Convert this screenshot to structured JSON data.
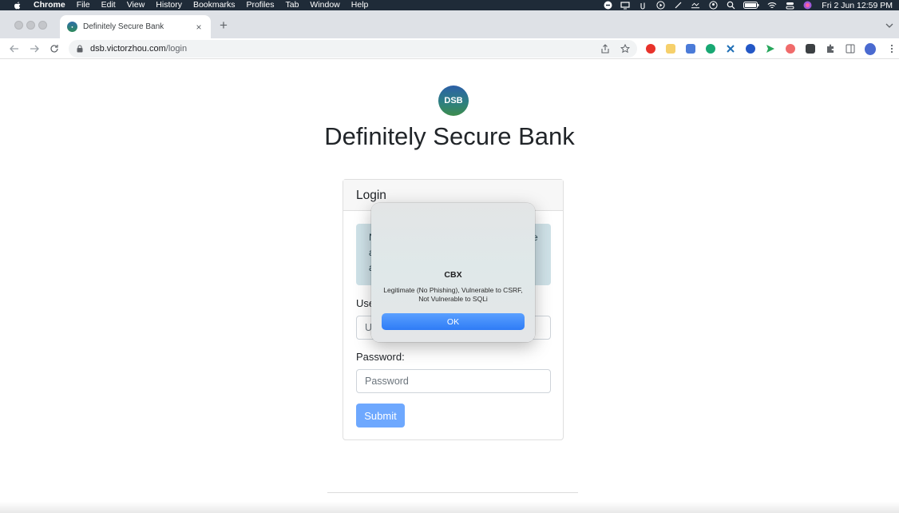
{
  "menubar": {
    "app_name": "Chrome",
    "items": [
      "File",
      "Edit",
      "View",
      "History",
      "Bookmarks",
      "Profiles",
      "Tab",
      "Window",
      "Help"
    ],
    "clock": "Fri 2 Jun  12:59 PM"
  },
  "browser": {
    "tab_title": "Definitely Secure Bank",
    "url_host": "dsb.victorzhou.com",
    "url_path": "/login",
    "new_tab_label": "+",
    "close_label": "×"
  },
  "page": {
    "logo_text": "DSB",
    "title": "Definitely Secure Bank",
    "card_title": "Login",
    "alert_fragments": [
      "N",
      "a",
      "a",
      "e"
    ],
    "username_label_partial": "Use",
    "username_placeholder_partial": "U",
    "password_label": "Password:",
    "password_placeholder": "Password",
    "submit_label": "Submit"
  },
  "dialog": {
    "title": "CBX",
    "message": "Legitimate (No Phishing), Vulnerable to CSRF, Not Vulnerable to SQLi",
    "ok_label": "OK"
  },
  "colors": {
    "menubar_bg": "#1f2b38",
    "tabstrip_bg": "#dee1e6",
    "alert_bg": "#cfe2e8",
    "submit_bg": "#6ea8fe",
    "dialog_button": "#2f7cf6"
  }
}
